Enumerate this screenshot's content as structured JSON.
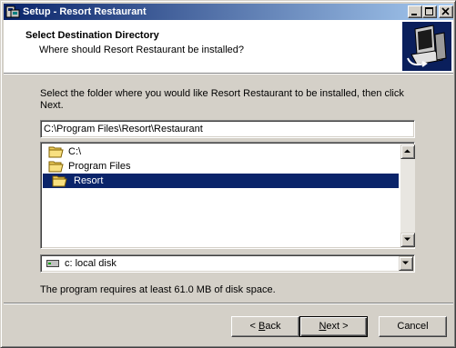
{
  "window": {
    "title": "Setup - Resort Restaurant",
    "controls": [
      "minimize",
      "maximize",
      "close"
    ]
  },
  "header": {
    "title": "Select Destination Directory",
    "subtitle": "Where should Resort Restaurant be installed?",
    "image_icon": "computer-install-icon"
  },
  "intro_text": "Select the folder where you would like Resort Restaurant to be installed, then click Next.",
  "path_input": {
    "value": "C:\\Program Files\\Resort\\Restaurant"
  },
  "folder_tree": {
    "items": [
      {
        "label": "C:\\",
        "icon": "open-folder-icon",
        "selected": false
      },
      {
        "label": "Program Files",
        "icon": "open-folder-icon",
        "selected": false
      },
      {
        "label": "Resort",
        "icon": "open-folder-icon",
        "selected": true
      }
    ]
  },
  "drive_select": {
    "value": "c: local disk",
    "icon": "hard-drive-icon"
  },
  "disk_space_text": "The program requires at least 61.0 MB of disk space.",
  "buttons": {
    "back": {
      "accel": "B",
      "rest": "ack",
      "prefix": "< "
    },
    "next": {
      "accel": "N",
      "rest": "ext",
      "suffix": " >"
    },
    "cancel": "Cancel"
  },
  "colors": {
    "titlebar_start": "#0a246a",
    "titlebar_end": "#a6caf0",
    "selection": "#0a246a",
    "face": "#d4d0c8"
  }
}
